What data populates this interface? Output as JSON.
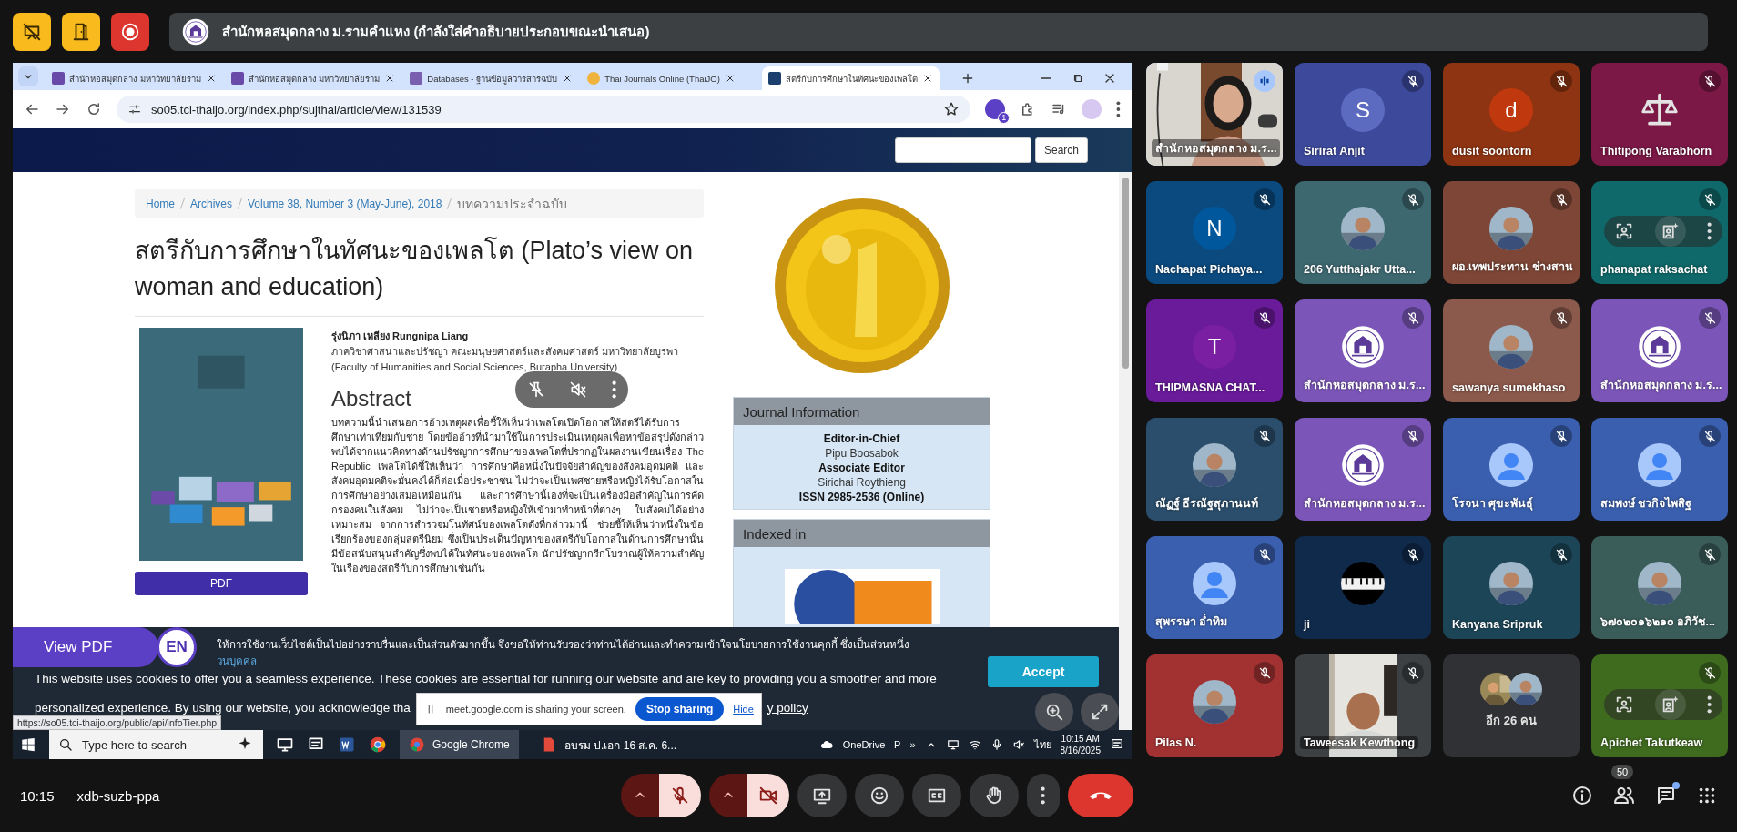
{
  "presenter_bar": {
    "text": "สำนักหอสมุดกลาง ม.รามคำแหง (กำลังใส่คำอธิบายประกอบขณะนำเสนอ)"
  },
  "shared_screen": {
    "browser": {
      "tabs": [
        {
          "title": "สำนักหอสมุดกลาง มหาวิทยาลัยราม",
          "selected": false
        },
        {
          "title": "สำนักหอสมุดกลาง มหาวิทยาลัยราม",
          "selected": false
        },
        {
          "title": "Databases - ฐานข้อมูลวารสารฉบับ",
          "selected": false
        },
        {
          "title": "Thai Journals Online (ThaiJO)",
          "selected": false
        },
        {
          "title": "สตรีกับการศึกษาในทัศนะของเพลโต",
          "selected": true
        }
      ],
      "address": "so05.tci-thaijo.org/index.php/sujthai/article/view/131539",
      "profile_badge": "1"
    },
    "page": {
      "search_button": "Search",
      "breadcrumb": [
        "Home",
        "Archives",
        "Volume 38, Number 3 (May-June), 2018",
        "บทความประจำฉบับ"
      ],
      "title": "สตรีกับการศึกษาในทัศนะของเพลโต (Plato’s view on woman and education)",
      "author": "รุ่งนิภา เหลียง Rungnipa Liang",
      "affiliation": [
        "ภาควิชาศาสนาและปรัชญา คณะมนุษยศาสตร์และสังคมศาสตร์ มหาวิทยาลัยบูรพา",
        "(Faculty of Humanities and Social Sciences, Burapha University)"
      ],
      "pdf_button": "PDF",
      "abstract_heading": "Abstract",
      "abstract": "บทความนี้นำเสนอการอ้างเหตุผลเพื่อชี้ให้เห็นว่าเพลโตเปิดโอกาสให้สตรีได้รับการศึกษาเท่าเทียมกับชาย โดยข้ออ้างที่นำมาใช้ในการประเมินเหตุผลเพื่อหาข้อสรุปดังกล่าวพบได้จากแนวคิดทางด้านปรัชญาการศึกษาของเพลโตที่ปรากฏในผลงานเขียนเรื่อง The Republic เพลโตได้ชี้ให้เห็นว่า การศึกษาคือหนึ่งในปัจจัยสำคัญของสังคมอุดมคติ และสังคมอุดมคติจะมั่นคงได้ก็ต่อเมื่อประชาชน ไม่ว่าจะเป็นเพศชายหรือหญิงได้รับโอกาสในการศึกษาอย่างเสมอเหมือนกัน และการศึกษานี้เองที่จะเป็นเครื่องมือสำคัญในการคัดกรองคนในสังคม ไม่ว่าจะเป็นชายหรือหญิงให้เข้ามาทำหน้าที่ต่างๆ ในสังคมได้อย่างเหมาะสม จากการสำรวจมโนทัศน์ของเพลโตดังที่กล่าวมานี้ ช่วยชี้ให้เห็นว่าหนึ่งในข้อเรียกร้องของกลุ่มสตรีนิยม ซึ่งเป็นประเด็นปัญหาของสตรีกับโอกาสในด้านการศึกษานั้นมีข้อสนับสนุนสำคัญซึ่งพบได้ในทัศนะของเพลโต นักปรัชญากรีกโบราณผู้ให้ความสำคัญในเรื่องของสตรีกับการศึกษาเช่นกัน",
      "journal_info": {
        "heading": "Journal Information",
        "lines": [
          {
            "text": "Editor-in-Chief",
            "bold": true
          },
          {
            "text": "Pipu Boosabok",
            "bold": false
          },
          {
            "text": "Associate Editor",
            "bold": true
          },
          {
            "text": "Sirichai Roythieng",
            "bold": false
          },
          {
            "text": "ISSN 2985-2536 (Online)",
            "bold": true
          }
        ]
      },
      "indexed_in": {
        "heading": "Indexed in"
      },
      "view_pdf": "View PDF",
      "language": "EN"
    },
    "cookie_notice": {
      "thai_text": "ให้การใช้งานเว็บไซต์เป็นไปอย่างราบรื่นและเป็นส่วนตัวมากขึ้น จึงขอให้ท่านรับรองว่าท่านได้อ่านและทำความเข้าใจนโยบายการใช้งานคุกกี้ ซึ่งเป็นส่วนหนึ่ง",
      "thai_link": "วนบุคคล",
      "english_line": "This website uses cookies to offer you a seamless experience. These cookies are essential for running our website and are key to providing you a smoother and more",
      "english_tail": "personalized experience. By using our website, you acknowledge tha",
      "policy_link": "y policy",
      "accept": "Accept"
    },
    "share_notice": {
      "text": "meet.google.com is sharing your screen.",
      "stop": "Stop sharing",
      "hide": "Hide"
    },
    "status_url": "https://so05.tci-thaijo.org/public/api/infoTier.php",
    "taskbar": {
      "search_placeholder": "Type here to search",
      "apps": [
        {
          "label": "Google Chrome",
          "selected": true
        },
        {
          "label": "อบรม ป.เอก 16 ส.ค. 6...",
          "selected": false
        }
      ],
      "onedrive": "OneDrive - P",
      "overflow": "»",
      "language": "ไทย",
      "time": "10:15 AM",
      "date": "8/16/2025"
    }
  },
  "participants": [
    {
      "name": "สำนักหอสมุดกลาง ม.ร...",
      "color": "#c9c4bc",
      "avatar": {
        "kind": "video"
      },
      "muted": false,
      "speaking": true,
      "hovered": false
    },
    {
      "name": "Sirirat Anjit",
      "color": "#3d4a9c",
      "avatar": {
        "kind": "letter",
        "letter": "S",
        "color": "#5c6bc0"
      },
      "muted": true,
      "speaking": false,
      "hovered": false
    },
    {
      "name": "dusit soontorn",
      "color": "#8e3412",
      "avatar": {
        "kind": "letter",
        "letter": "d",
        "color": "#c0390e"
      },
      "muted": true,
      "speaking": false,
      "hovered": false
    },
    {
      "name": "Thitipong Varabhorn",
      "color": "#7b1846",
      "avatar": {
        "kind": "scales"
      },
      "muted": true,
      "speaking": false,
      "hovered": false
    },
    {
      "name": "Nachapat Pichaya...",
      "color": "#0b4a7e",
      "avatar": {
        "kind": "letter",
        "letter": "N",
        "color": "#01579b"
      },
      "muted": true,
      "speaking": false,
      "hovered": false
    },
    {
      "name": "206 Yutthajakr Utta...",
      "color": "#3e6870",
      "muted": true,
      "speaking": false,
      "hovered": false
    },
    {
      "name": "ผอ.เทพประทาน ช่างสาน",
      "color": "#7d4636",
      "muted": true,
      "speaking": false,
      "hovered": false
    },
    {
      "name": "phanapat raksachat",
      "color": "#0f6869",
      "avatar": {
        "kind": "none"
      },
      "muted": true,
      "speaking": false,
      "hovered": true
    },
    {
      "name": "THIPMASNA CHAT...",
      "color": "#6a1b9a",
      "avatar": {
        "kind": "letter",
        "letter": "T",
        "color": "#7b1fa2"
      },
      "muted": true,
      "speaking": false,
      "hovered": false
    },
    {
      "name": "สำนักหอสมุดกลาง ม.ร...",
      "color": "#7b56b8",
      "avatar": {
        "kind": "logo"
      },
      "muted": true,
      "speaking": false,
      "hovered": false
    },
    {
      "name": "sawanya sumekhaso",
      "color": "#8c5a4c",
      "muted": true,
      "speaking": false,
      "hovered": false
    },
    {
      "name": "สำนักหอสมุดกลาง ม.ร...",
      "color": "#7b56b8",
      "avatar": {
        "kind": "logo"
      },
      "muted": true,
      "speaking": false,
      "hovered": false
    },
    {
      "name": "ณัฏฐ์ ธีรณัฐสุภานนท์",
      "color": "#2b4e6c",
      "muted": true,
      "speaking": false,
      "hovered": false
    },
    {
      "name": "สำนักหอสมุดกลาง ม.ร...",
      "color": "#7b56b8",
      "avatar": {
        "kind": "logo"
      },
      "muted": true,
      "speaking": false,
      "hovered": false
    },
    {
      "name": "โรจนา ศุขะพันธุ์",
      "color": "#3a5fae",
      "avatar": {
        "kind": "default"
      },
      "muted": true,
      "speaking": false,
      "hovered": false
    },
    {
      "name": "สมพงษ์ ชวกิจไพสิฐ",
      "color": "#3a5fae",
      "avatar": {
        "kind": "default"
      },
      "muted": true,
      "speaking": false,
      "hovered": false
    },
    {
      "name": "สุพรรษา อ่ำทิม",
      "color": "#3a5fae",
      "avatar": {
        "kind": "default"
      },
      "muted": true,
      "speaking": false,
      "hovered": false
    },
    {
      "name": "ji",
      "color": "#102a4c",
      "avatar": {
        "kind": "piano"
      },
      "muted": true,
      "speaking": false,
      "hovered": false
    },
    {
      "name": "Kanyana Sripruk",
      "color": "#1c4658",
      "muted": true,
      "speaking": false,
      "hovered": false
    },
    {
      "name": "๖๗๐๒๐๑๖๒๑๐ อภิวัช...",
      "color": "#3b5d5a",
      "muted": true,
      "speaking": false,
      "hovered": false
    },
    {
      "name": "Pilas N.",
      "color": "#a23232",
      "muted": true,
      "speaking": false,
      "hovered": false
    },
    {
      "name": "Taweesak Kewthong",
      "color": "#3c4043",
      "avatar": {
        "kind": "video"
      },
      "muted": true,
      "speaking": false,
      "hovered": false
    },
    {
      "name": "อีก 26 คน",
      "color": "#303134",
      "avatar": {
        "kind": "group"
      },
      "muted": false,
      "speaking": false,
      "hovered": false
    },
    {
      "name": "Apichet Takutkeaw",
      "color": "#3f6b1f",
      "avatar": {
        "kind": "none"
      },
      "muted": true,
      "speaking": false,
      "hovered": true
    }
  ],
  "bottom_bar": {
    "time": "10:15",
    "meeting_code": "xdb-suzb-ppa",
    "mic_on": false,
    "camera_on": false,
    "people_count": "50",
    "chat_unread": true
  }
}
